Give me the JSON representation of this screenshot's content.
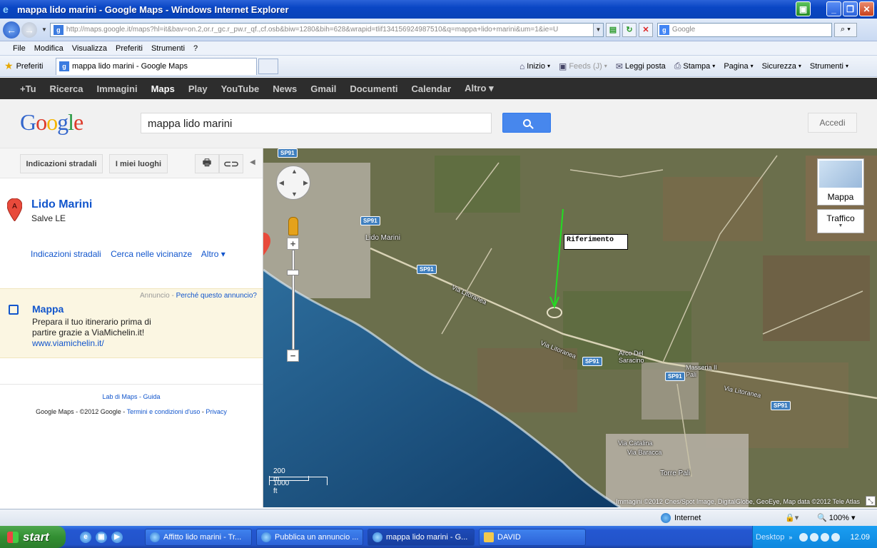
{
  "window": {
    "title": "mappa lido marini - Google Maps - Windows Internet Explorer",
    "url": "http://maps.google.it/maps?hl=it&bav=on.2,or.r_gc.r_pw.r_qf.,cf.osb&biw=1280&bih=628&wrapid=tlif134156924987510&q=mappa+lido+marini&um=1&ie=U",
    "search_placeholder": "Google"
  },
  "menu": [
    "File",
    "Modifica",
    "Visualizza",
    "Preferiti",
    "Strumenti",
    "?"
  ],
  "favbar": {
    "preferiti": "Preferiti",
    "tab_title": "mappa lido marini - Google Maps",
    "commands": [
      {
        "label": "Inizio",
        "icon": "home-icon",
        "dim": false
      },
      {
        "label": "Feeds (J)",
        "icon": "feeds-icon",
        "dim": true
      },
      {
        "label": "Leggi posta",
        "icon": "mail-icon",
        "dim": false
      },
      {
        "label": "Stampa",
        "icon": "print-icon",
        "dim": false
      },
      {
        "label": "Pagina",
        "icon": "",
        "dim": false
      },
      {
        "label": "Sicurezza",
        "icon": "",
        "dim": false
      },
      {
        "label": "Strumenti",
        "icon": "",
        "dim": false
      }
    ]
  },
  "gbar": [
    "+Tu",
    "Ricerca",
    "Immagini",
    "Maps",
    "Play",
    "YouTube",
    "News",
    "Gmail",
    "Documenti",
    "Calendar",
    "Altro ▾"
  ],
  "gbar_active": "Maps",
  "header": {
    "query": "mappa lido marini",
    "signin": "Accedi"
  },
  "left": {
    "btn_directions": "Indicazioni stradali",
    "btn_places": "I miei luoghi",
    "result_title": "Lido Marini",
    "result_sub": "Salve LE",
    "pin_letter": "A",
    "links": [
      "Indicazioni stradali",
      "Cerca nelle vicinanze",
      "Altro ▾"
    ],
    "ad": {
      "label": "Annuncio",
      "why": "Perché questo annuncio?",
      "title": "Mappa",
      "text": "Prepara il tuo itinerario prima di partire grazie a ViaMichelin.it!",
      "url": "www.viamichelin.it/"
    },
    "footer": {
      "lab": "Lab di Maps",
      "guide": "Guida",
      "copy": "Google Maps - ©2012 Google - ",
      "terms": "Termini e condizioni d'uso",
      "privacy": "Privacy"
    }
  },
  "map": {
    "riferimento": "Riferimento",
    "type_label": "Mappa",
    "traffic_label": "Traffico",
    "scale_m": "200 m",
    "scale_ft": "1000 ft",
    "copyright": "Immagini ©2012 Cnes/Spot Image, DigitalGlobe, GeoEye, Map data ©2012 Tele Atlas",
    "labels": {
      "lido_marini": "Lido Marini",
      "via_litoranea_1": "Via Litoranea",
      "via_litoranea_2": "Via Litoranea",
      "via_litoranea_3": "Via Litoranea",
      "arco": "Arco Del Saracino",
      "masseria": "Masseria Il Pali",
      "torre_pali": "Torre Pali",
      "via_catalina": "Via Catalina",
      "via_baracca": "Via Baracca"
    },
    "shields": {
      "sp91_a": "SP91",
      "sp91_b": "SP91",
      "sp91_c": "SP91",
      "sp91_d": "SP91",
      "sp91_e": "SP91",
      "sp91_f": "SP91"
    }
  },
  "status": {
    "zone": "Internet",
    "zoom": "100%"
  },
  "taskbar": {
    "start": "start",
    "tasks": [
      {
        "label": "Affitto lido marini - Tr...",
        "active": false,
        "folder": false
      },
      {
        "label": "Pubblica un annuncio ...",
        "active": false,
        "folder": false
      },
      {
        "label": "mappa lido marini - G...",
        "active": true,
        "folder": false
      },
      {
        "label": "DAVID",
        "active": false,
        "folder": true
      }
    ],
    "desktop": "Desktop",
    "clock": "12.09"
  }
}
